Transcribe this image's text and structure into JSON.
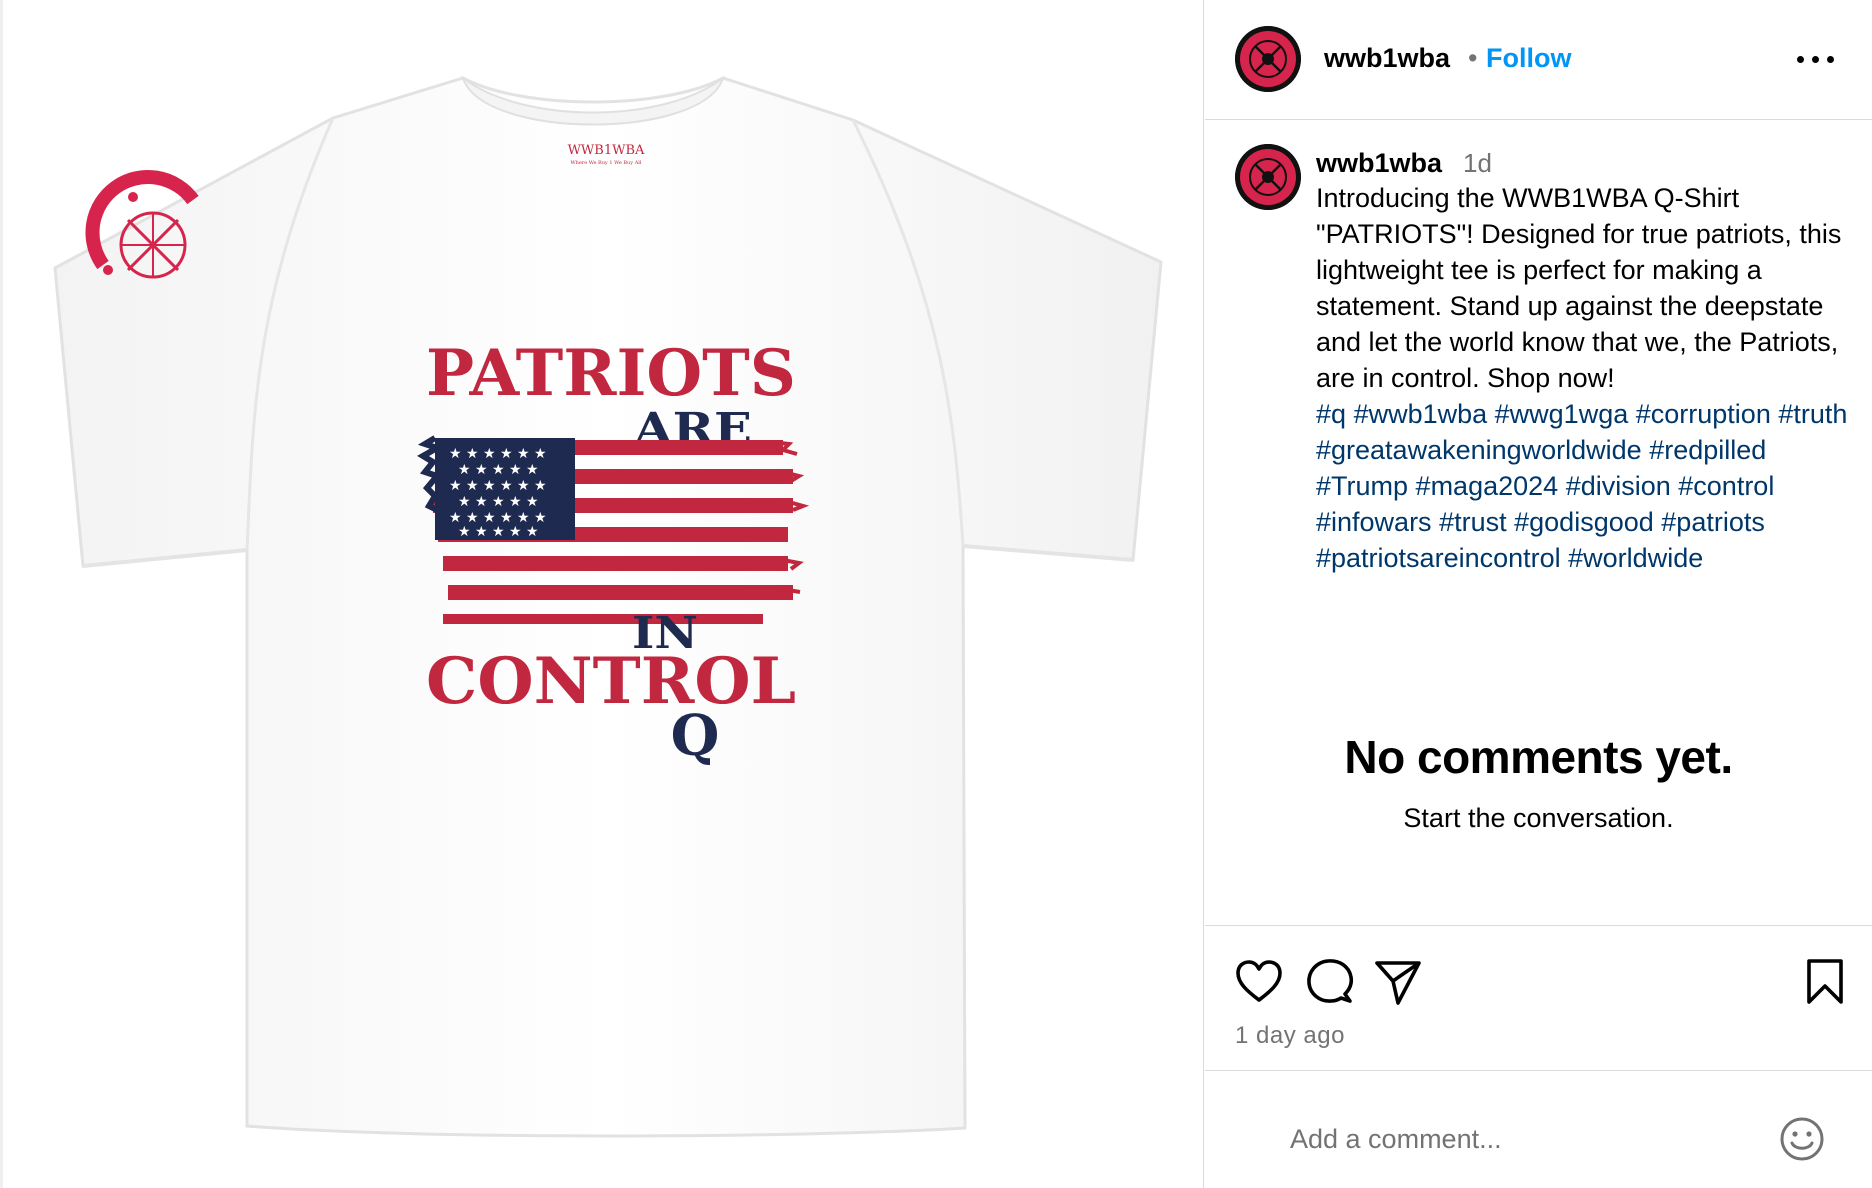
{
  "post": {
    "username": "wwb1wba",
    "separator": "•",
    "follow_label": "Follow",
    "caption_time": "1d",
    "caption_text": "Introducing the WWB1WBA Q-Shirt \"PATRIOTS\"! Designed for true patriots, this lightweight tee is perfect for making a statement. Stand up against the deepstate and let the world know that we, the Patriots, are in control. Shop now!",
    "hashtags": [
      "#q",
      "#wwb1wba",
      "#wwg1wga",
      "#corruption",
      "#truth",
      "#greatawakeningworldwide",
      "#redpilled",
      "#Trump",
      "#maga2024",
      "#division",
      "#control",
      "#infowars",
      "#trust",
      "#godisgood",
      "#patriots",
      "#patriotsareincontrol",
      "#worldwide"
    ],
    "empty_title": "No comments yet.",
    "empty_subtitle": "Start the conversation.",
    "posted_ago": "1 day ago",
    "comment_placeholder": "Add a comment..."
  },
  "shirt": {
    "collar_brand": "WWB1WBA",
    "collar_tagline": "Where We Buy 1 We Buy All",
    "line1": "PATRIOTS",
    "line2": "ARE",
    "line3": "IN",
    "line4": "CONTROL",
    "line5": "Q"
  },
  "colors": {
    "follow": "#0095f6",
    "hashtag": "#00376b",
    "print_red": "#c1273f",
    "print_navy": "#1e2a4f",
    "secondary_text": "#737373"
  },
  "icons": {
    "like": "heart-icon",
    "comment": "speech-bubble-icon",
    "share": "paper-plane-icon",
    "save": "bookmark-icon",
    "more": "ellipsis-icon",
    "emoji": "smiley-icon"
  }
}
